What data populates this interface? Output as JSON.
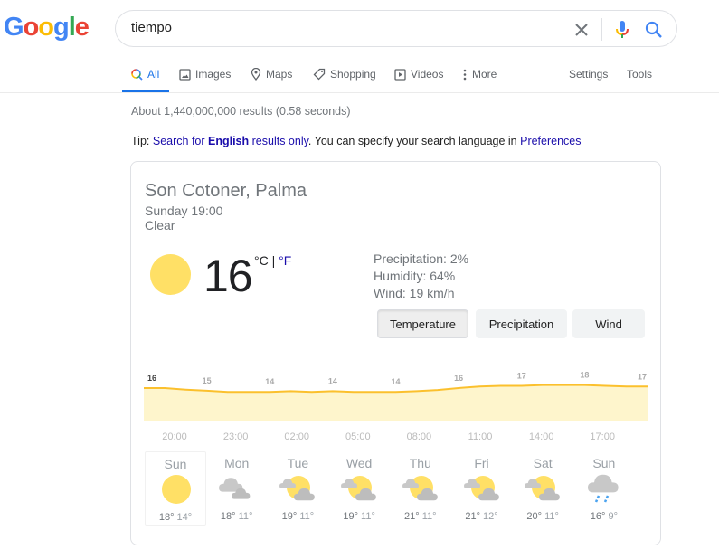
{
  "logo": {
    "letters": [
      "G",
      "o",
      "o",
      "g",
      "l",
      "e"
    ],
    "colors": [
      "#4285f4",
      "#ea4335",
      "#fbbc05",
      "#4285f4",
      "#34a853",
      "#ea4335"
    ]
  },
  "search": {
    "value": "tiempo",
    "placeholder": ""
  },
  "tabs": [
    {
      "label": "All",
      "icon": "search-icon",
      "active": true
    },
    {
      "label": "Images",
      "icon": "image-icon"
    },
    {
      "label": "Maps",
      "icon": "map-pin-icon"
    },
    {
      "label": "Shopping",
      "icon": "tag-icon"
    },
    {
      "label": "Videos",
      "icon": "play-icon"
    },
    {
      "label": "More",
      "icon": "more-vert-icon"
    }
  ],
  "tools": {
    "settings": "Settings",
    "tools": "Tools"
  },
  "results_stats": "About 1,440,000,000 results (0.58 seconds)",
  "tip": {
    "prefix": "Tip: ",
    "link1_a": "Search for ",
    "link1_b": "English",
    "link1_c": " results only",
    "middle": ". You can specify your search language in ",
    "link2": "Preferences"
  },
  "weather": {
    "location": "Son Cotoner, Palma",
    "datetime": "Sunday 19:00",
    "condition": "Clear",
    "temperature": "16",
    "unit_c": "°C",
    "unit_sep": " | ",
    "unit_f": "°F",
    "precipitation": "Precipitation: 2%",
    "humidity": "Humidity: 64%",
    "wind": "Wind: 19 km/h",
    "buttons": [
      "Temperature",
      "Precipitation",
      "Wind"
    ],
    "selected_button": "Temperature",
    "colors": {
      "line": "#fbc02d",
      "fill": "#fef5cc",
      "sun": "#ffe066"
    }
  },
  "chart_data": {
    "type": "area",
    "title": "Temperature",
    "x_labels": [
      "20:00",
      "23:00",
      "02:00",
      "05:00",
      "08:00",
      "11:00",
      "14:00",
      "17:00"
    ],
    "label_values": [
      16,
      15,
      14,
      14,
      14,
      16,
      17,
      18,
      17
    ],
    "series": [
      {
        "name": "Temperature (°C)",
        "values": [
          16,
          16,
          15.6,
          15.3,
          15,
          15,
          15,
          15.2,
          15,
          15.2,
          15,
          15,
          15,
          15.2,
          15.5,
          16,
          16.4,
          16.6,
          16.6,
          16.8,
          16.8,
          16.8,
          16.6,
          16.4,
          16.4
        ]
      }
    ],
    "ylim": [
      10,
      20
    ],
    "grid": false,
    "legend": "none"
  },
  "forecast": [
    {
      "day": "Sun",
      "icon": "sun",
      "hi": "18°",
      "lo": "14°",
      "selected": true
    },
    {
      "day": "Mon",
      "icon": "cloudy",
      "hi": "18°",
      "lo": "11°"
    },
    {
      "day": "Tue",
      "icon": "partly-cloudy",
      "hi": "19°",
      "lo": "11°"
    },
    {
      "day": "Wed",
      "icon": "partly-cloudy",
      "hi": "19°",
      "lo": "11°"
    },
    {
      "day": "Thu",
      "icon": "partly-cloudy",
      "hi": "21°",
      "lo": "11°"
    },
    {
      "day": "Fri",
      "icon": "partly-cloudy",
      "hi": "21°",
      "lo": "12°"
    },
    {
      "day": "Sat",
      "icon": "partly-cloudy",
      "hi": "20°",
      "lo": "11°"
    },
    {
      "day": "Sun",
      "icon": "rain",
      "hi": "16°",
      "lo": "9°"
    }
  ]
}
